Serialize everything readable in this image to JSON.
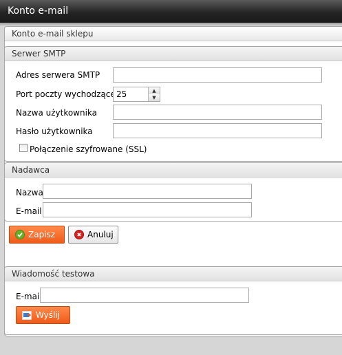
{
  "window": {
    "title": "Konto e-mail"
  },
  "panel": {
    "title": "Konto e-mail sklepu"
  },
  "smtp": {
    "legend": "Serwer SMTP",
    "server_label": "Adres serwera SMTP",
    "server_value": "",
    "port_label": "Port poczty wychodzącej",
    "port_value": "25",
    "user_label": "Nazwa użytkownika",
    "user_value": "",
    "password_label": "Hasło użytkownika",
    "password_value": "",
    "ssl_label": "Połączenie szyfrowane (SSL)",
    "ssl_checked": false
  },
  "sender": {
    "legend": "Nadawca",
    "name_label": "Nazwa",
    "name_value": "",
    "email_label": "E-mail",
    "email_value": ""
  },
  "actions": {
    "save_label": "Zapisz",
    "cancel_label": "Anuluj"
  },
  "test": {
    "legend": "Wiadomość testowa",
    "email_label": "E-mail",
    "email_value": "",
    "send_label": "Wyślij"
  },
  "colors": {
    "primary_button": "#f26522",
    "titlebar": "#262626"
  },
  "icons": {
    "save": "check-circle-icon",
    "cancel": "cancel-circle-icon",
    "send": "send-mail-icon",
    "spin_up": "spin-up-icon",
    "spin_down": "spin-down-icon"
  }
}
